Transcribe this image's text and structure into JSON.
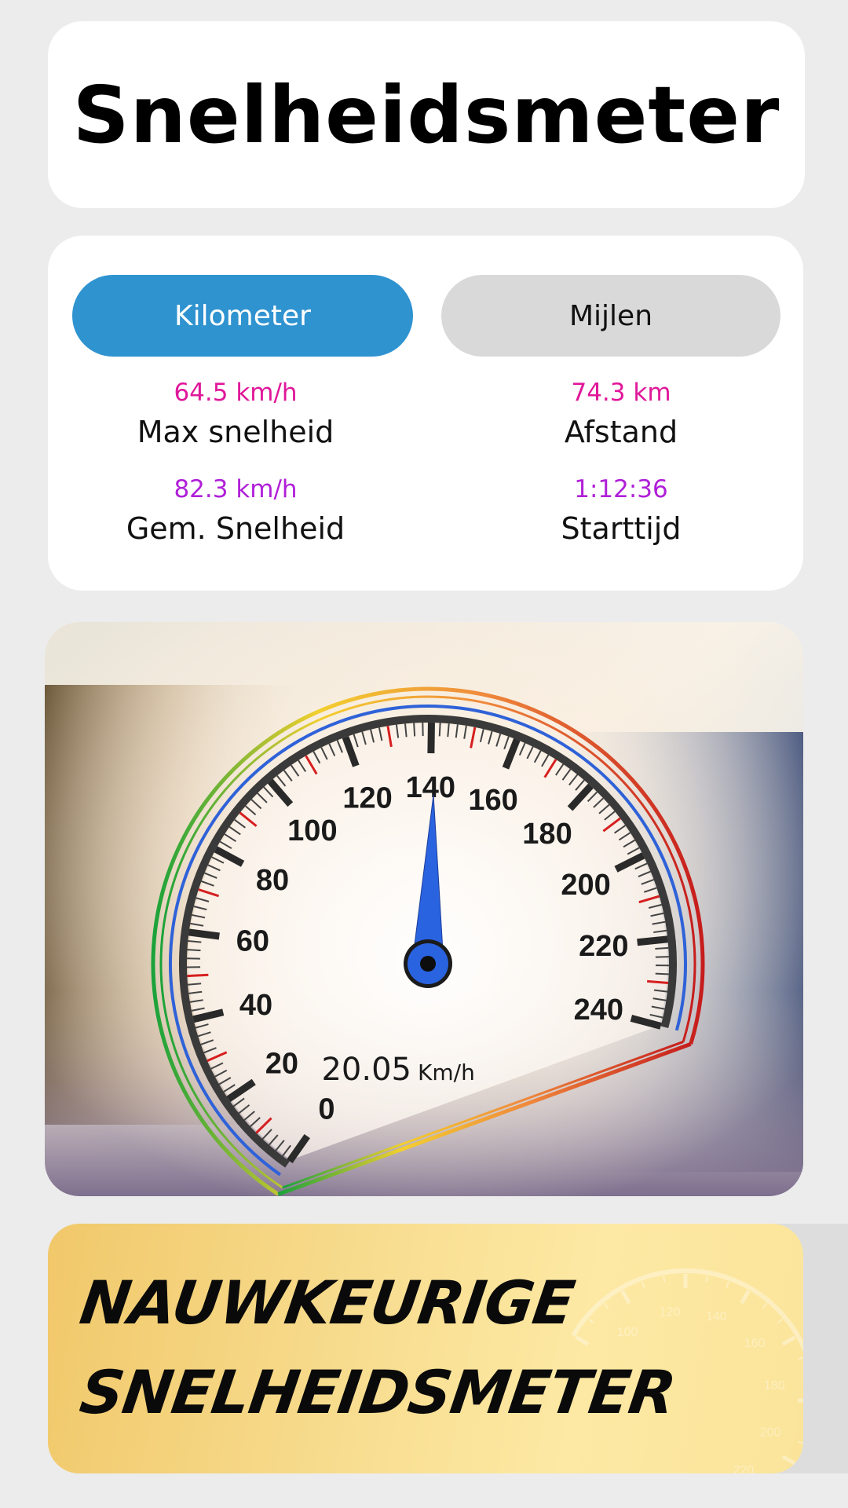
{
  "title": "Snelheidsmeter",
  "tabs": {
    "kilometer": "Kilometer",
    "miles": "Mijlen",
    "selected": "kilometer"
  },
  "stats": {
    "max_speed": {
      "value": "64.5 km/h",
      "label": "Max snelheid"
    },
    "distance": {
      "value": "74.3 km",
      "label": "Afstand"
    },
    "avg_speed": {
      "value": "82.3 km/h",
      "label": "Gem. Snelheid"
    },
    "start_time": {
      "value": "1:12:36",
      "label": "Starttijd"
    }
  },
  "colors": {
    "accent_blue": "#2f93d0",
    "max_value": "#e0189a",
    "avg_value": "#b020d8",
    "needle": "#2a63e0"
  },
  "gauge": {
    "speed_value": "20.05",
    "speed_unit": "Km/h",
    "needle_speed": 141,
    "scale_min": 0,
    "scale_max": 240,
    "labels": [
      "0",
      "20",
      "40",
      "60",
      "80",
      "100",
      "120",
      "140",
      "160",
      "180",
      "200",
      "220",
      "240"
    ]
  },
  "banner": {
    "line1": "NAUWKEURIGE",
    "line2": "SNELHEIDSMETER",
    "watermark_labels": [
      "100",
      "120",
      "140",
      "160",
      "180",
      "200",
      "220"
    ]
  }
}
